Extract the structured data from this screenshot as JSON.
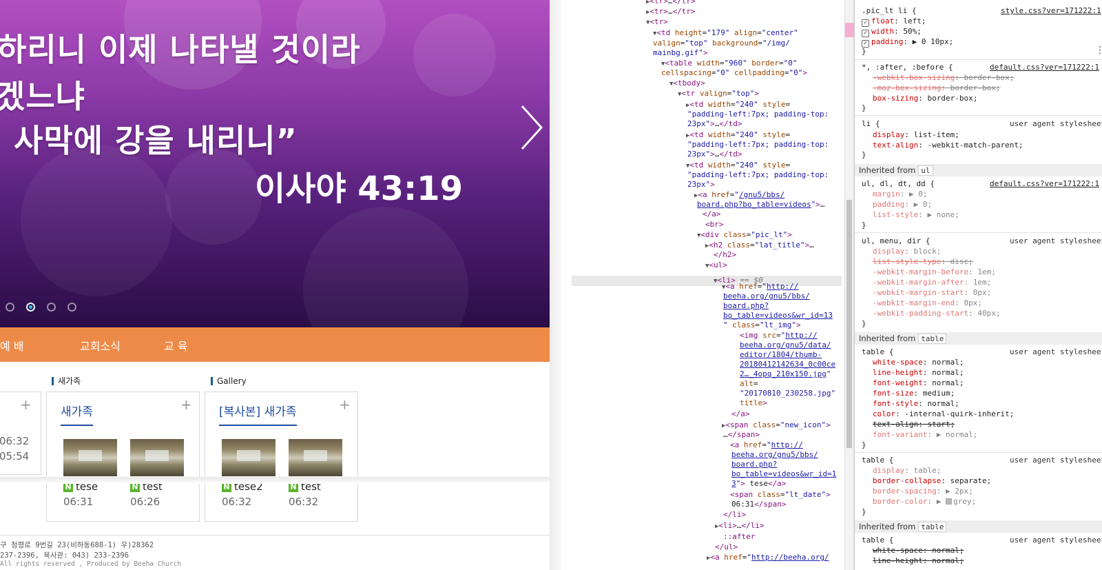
{
  "banner": {
    "verse_line1": "하리니 이제 나타낼 것이라",
    "verse_line2": "겠느냐",
    "verse_line3": "사막에 강을 내리니”",
    "reference": "이사야 43:19"
  },
  "nav": {
    "items": [
      "예 배",
      "교회소식",
      "교 육"
    ]
  },
  "sections": {
    "s1_title": "새가족",
    "s2_title": "Gallery"
  },
  "box0": {
    "time1": "06:32",
    "time2": "05:54"
  },
  "box1": {
    "heading": "새가족",
    "items": [
      {
        "badge": "N",
        "title": "tese",
        "time": "06:31"
      },
      {
        "badge": "N",
        "title": "test",
        "time": "06:26"
      }
    ]
  },
  "box2": {
    "heading": "[복사본] 새가족",
    "items": [
      {
        "badge": "N",
        "title": "tese2",
        "time": "06:32"
      },
      {
        "badge": "N",
        "title": "test",
        "time": "06:32"
      }
    ]
  },
  "footer": {
    "line1": "구 청평로 9번길 23(비하동688-1) 우)28362",
    "line2": " 237-2396, 목사관: 043) 233-2396",
    "line3": "All rights reserved , Produced by Beeha Church"
  },
  "elements": {
    "selected_marker": "== $0",
    "ellipsis": "..."
  },
  "styles": {
    "inherited_label": "Inherited from",
    "inherited": [
      "ul",
      "table",
      "table"
    ]
  },
  "colors": {
    "accent_orange": "#ee8a47",
    "heading_blue": "#1f4aa0",
    "highlight_pink": "#f7a1cd"
  }
}
